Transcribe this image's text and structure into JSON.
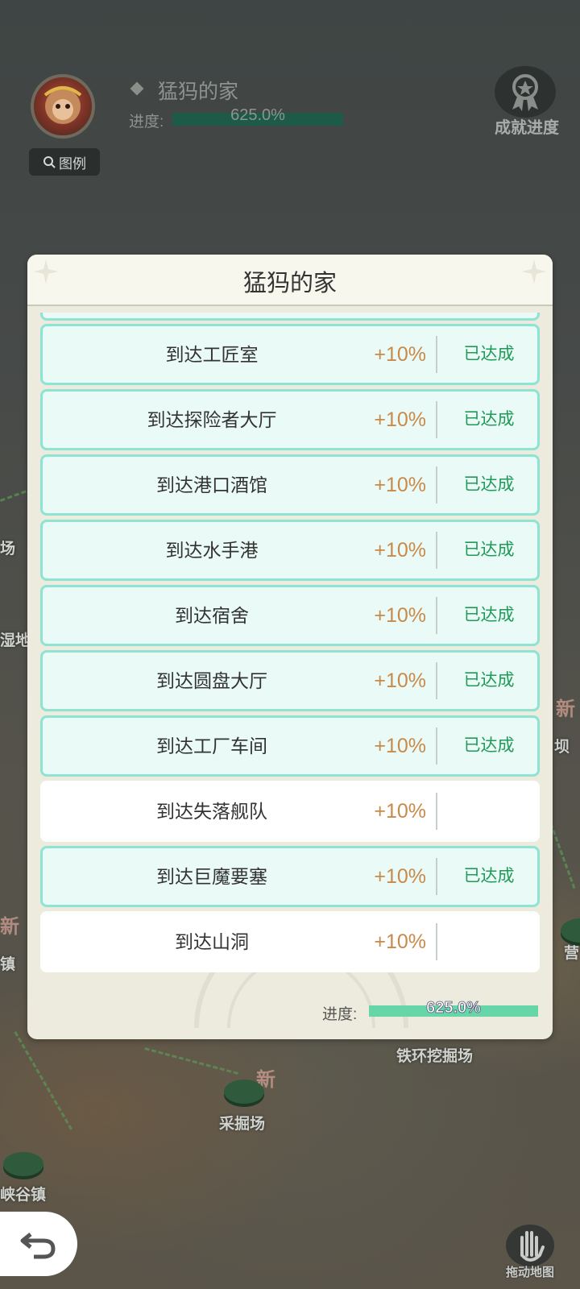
{
  "hud": {
    "legend_label": "图例",
    "title": "猛犸的家",
    "progress_label": "进度:",
    "progress_value": "625.0%",
    "progress_fraction": 1.0,
    "achievement_label": "成就进度"
  },
  "modal": {
    "title": "猛犸的家",
    "rows": [
      {
        "label": "到达工匠室",
        "pct": "+10%",
        "status": "已达成",
        "done": true
      },
      {
        "label": "到达探险者大厅",
        "pct": "+10%",
        "status": "已达成",
        "done": true
      },
      {
        "label": "到达港口酒馆",
        "pct": "+10%",
        "status": "已达成",
        "done": true
      },
      {
        "label": "到达水手港",
        "pct": "+10%",
        "status": "已达成",
        "done": true
      },
      {
        "label": "到达宿舍",
        "pct": "+10%",
        "status": "已达成",
        "done": true
      },
      {
        "label": "到达圆盘大厅",
        "pct": "+10%",
        "status": "已达成",
        "done": true
      },
      {
        "label": "到达工厂车间",
        "pct": "+10%",
        "status": "已达成",
        "done": true
      },
      {
        "label": "到达失落舰队",
        "pct": "+10%",
        "status": "",
        "done": false
      },
      {
        "label": "到达巨魔要塞",
        "pct": "+10%",
        "status": "已达成",
        "done": true
      },
      {
        "label": "到达山洞",
        "pct": "+10%",
        "status": "",
        "done": false
      }
    ],
    "footer_label": "进度:",
    "footer_value": "625.0%"
  },
  "map": {
    "labels": {
      "tiehuan": "铁环挖掘场",
      "caijue": "采掘场",
      "xiagu": "峡谷镇",
      "new1": "新",
      "new2": "新",
      "new3": "新",
      "edge_left1": "场",
      "edge_left2": "湿地",
      "edge_left3": "镇",
      "edge_right1": "坝",
      "edge_right2": "营"
    }
  },
  "drag_label": "拖动地图",
  "colors": {
    "row_done_bg": "#eafaf6",
    "row_done_border": "#8ee3d2",
    "pct_color": "#c88a4a",
    "status_color": "#1f9a57",
    "progress_bar": "#66d6a8"
  }
}
